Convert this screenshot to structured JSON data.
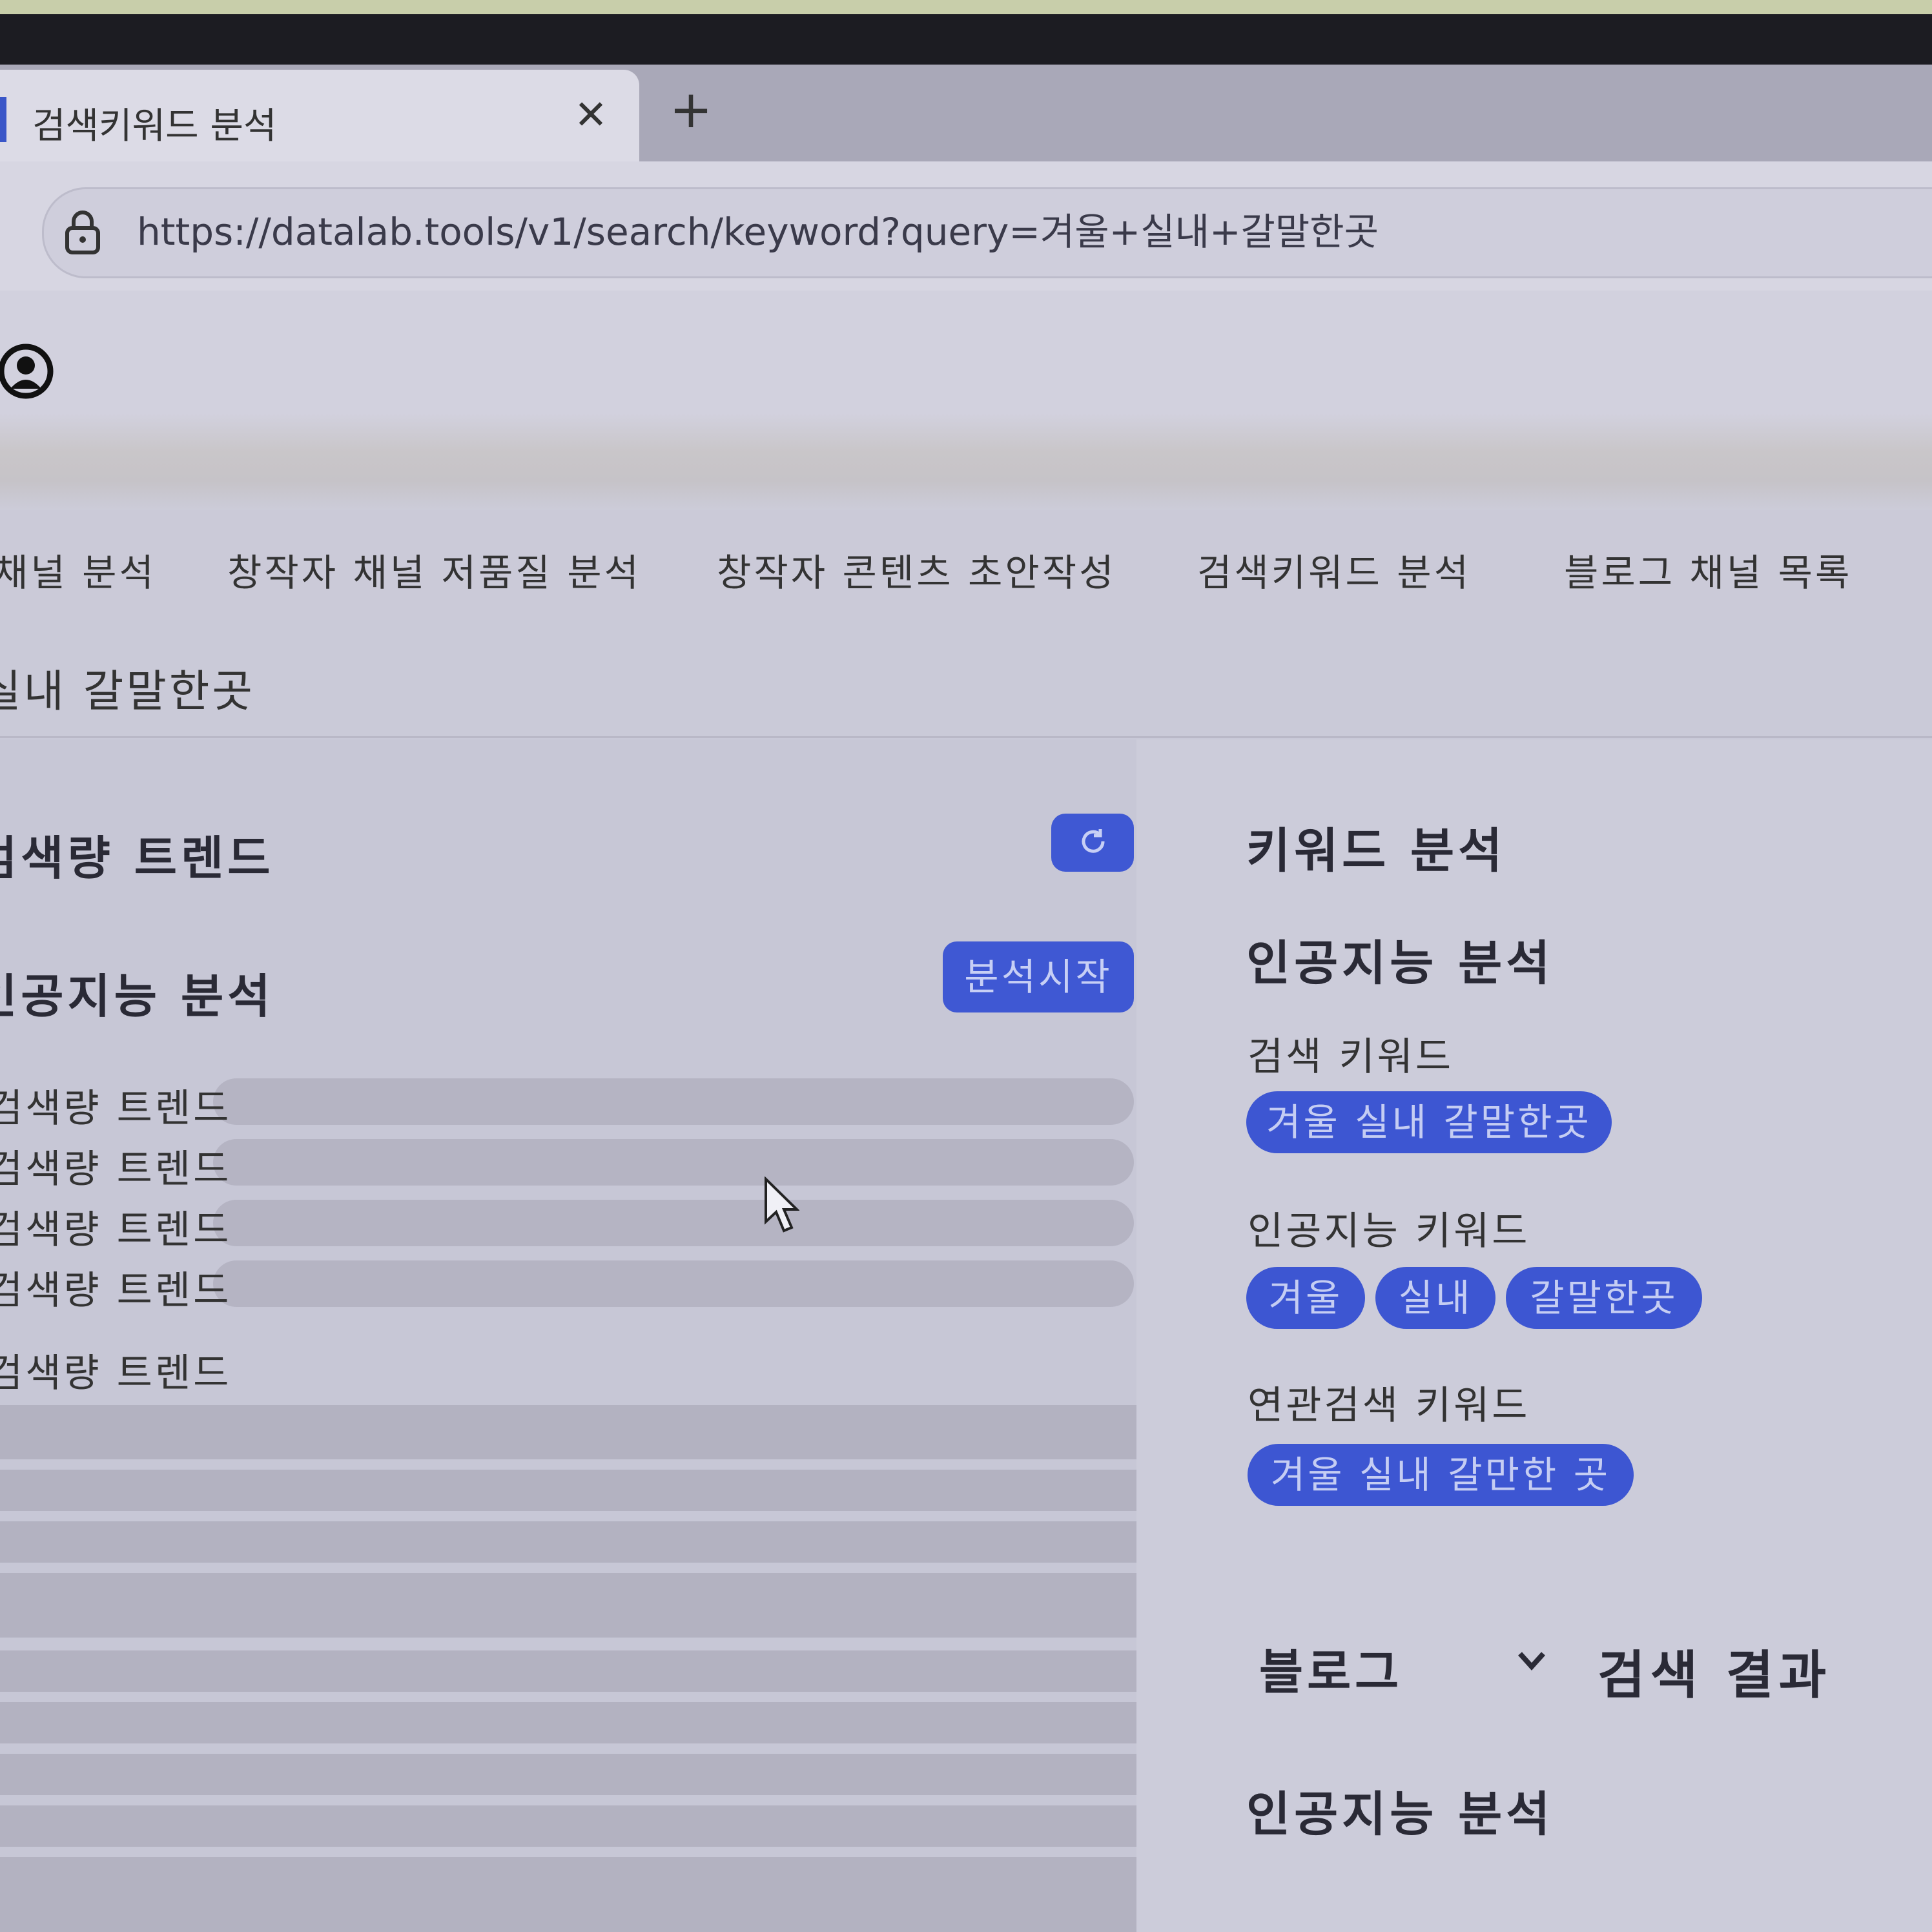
{
  "browser": {
    "tab_title": "검색키워드 분석",
    "tab_close": "✕",
    "new_tab": "+",
    "url": "https://datalab.tools/v1/search/keyword?query=겨울+실내+갈말한곳"
  },
  "nav": {
    "items": [
      {
        "label": "채널 분석"
      },
      {
        "label": "창작자 채널 저품질 분석"
      },
      {
        "label": "창작자 콘텐츠 초안작성"
      },
      {
        "label": "검색키워드 분석"
      },
      {
        "label": "블로그 채널 목록"
      }
    ]
  },
  "query": {
    "text": "실내 갈말한곳"
  },
  "left": {
    "trend_title": "검색량 트렌드",
    "ai_title": "인공지능 분석",
    "start_button": "분석시작",
    "trend_rows": [
      {
        "label": "검색량 트렌드"
      },
      {
        "label": "검색량 트렌드"
      },
      {
        "label": "검색량 트렌드"
      },
      {
        "label": "검색량 트렌드"
      },
      {
        "label": "검색량 트렌드"
      }
    ]
  },
  "right": {
    "keyword_title": "키워드 분석",
    "ai_title": "인공지능 분석",
    "search_keyword_label": "검색 키워드",
    "search_keyword_chip": "겨울 실내 갈말한곳",
    "ai_keyword_label": "인공지능 키워드",
    "ai_keyword_chips": [
      "겨울",
      "실내",
      "갈말한곳"
    ],
    "related_label": "연관검색 키워드",
    "related_chip": "겨울 실내 갈만한 곳",
    "source_select": "블로그",
    "result_title": "검색 결과",
    "ai_title_2": "인공지능 분석"
  },
  "colors": {
    "accent": "#3f58d3",
    "chip_text": "#c7cff5",
    "page_bg": "#c9c9d8"
  }
}
